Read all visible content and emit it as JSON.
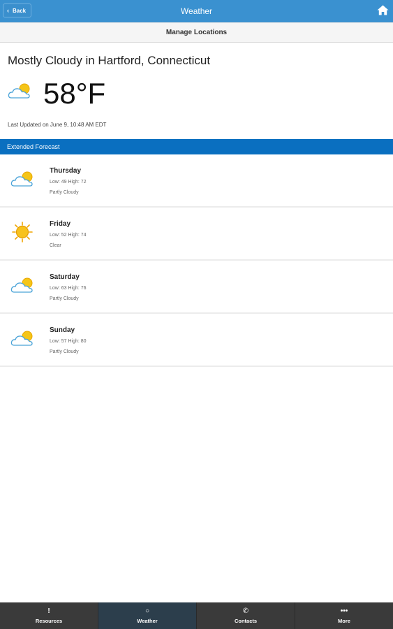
{
  "header": {
    "back_label": "Back",
    "title": "Weather",
    "home_icon": "home-icon"
  },
  "manage_locations_label": "Manage Locations",
  "current": {
    "title": "Mostly Cloudy in Hartford, Connecticut",
    "temperature": "58°F",
    "icon": "partly-cloudy-icon",
    "last_updated": "Last Updated on June 9, 10:48 AM EDT"
  },
  "extended_forecast_label": "Extended Forecast",
  "forecast": [
    {
      "day": "Thursday",
      "low_high": "Low: 49 High: 72",
      "condition": "Partly Cloudy",
      "icon": "partly-cloudy-icon"
    },
    {
      "day": "Friday",
      "low_high": "Low: 52 High: 74",
      "condition": "Clear",
      "icon": "sun-icon"
    },
    {
      "day": "Saturday",
      "low_high": "Low: 63 High: 76",
      "condition": "Partly Cloudy",
      "icon": "partly-cloudy-icon"
    },
    {
      "day": "Sunday",
      "low_high": "Low: 57 High: 80",
      "condition": "Partly Cloudy",
      "icon": "partly-cloudy-icon"
    }
  ],
  "tabs": [
    {
      "label": "Resources",
      "icon": "exclamation-icon",
      "glyph": "!"
    },
    {
      "label": "Weather",
      "icon": "circle-icon",
      "glyph": "○",
      "active": true
    },
    {
      "label": "Contacts",
      "icon": "phone-icon",
      "glyph": "✆"
    },
    {
      "label": "More",
      "icon": "more-icon",
      "glyph": "•••"
    }
  ],
  "colors": {
    "header_blue": "#3a91d0",
    "extended_blue": "#0a6fc0",
    "tabbar": "#3a3a3a",
    "tab_active": "#2c3e4c"
  }
}
